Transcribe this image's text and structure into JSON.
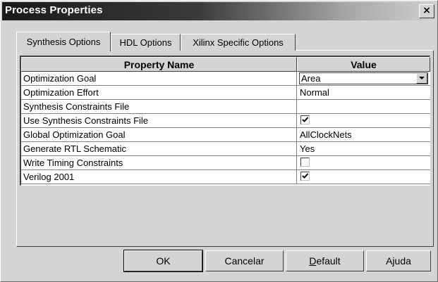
{
  "window": {
    "title": "Process Properties",
    "close_label": "×"
  },
  "tabs": [
    {
      "label": "Synthesis Options",
      "active": true
    },
    {
      "label": "HDL Options",
      "active": false
    },
    {
      "label": "Xilinx Specific Options",
      "active": false
    }
  ],
  "table": {
    "headers": {
      "name": "Property Name",
      "value": "Value"
    },
    "rows": [
      {
        "name": "Optimization Goal",
        "value": "Area",
        "kind": "dropdown"
      },
      {
        "name": "Optimization Effort",
        "value": "Normal",
        "kind": "text"
      },
      {
        "name": "Synthesis Constraints File",
        "value": "",
        "kind": "text"
      },
      {
        "name": "Use Synthesis Constraints File",
        "value": "checked",
        "kind": "checkbox"
      },
      {
        "name": "Global Optimization Goal",
        "value": "AllClockNets",
        "kind": "text"
      },
      {
        "name": "Generate RTL Schematic",
        "value": "Yes",
        "kind": "text"
      },
      {
        "name": "Write Timing Constraints",
        "value": "unchecked",
        "kind": "checkbox"
      },
      {
        "name": "Verilog 2001",
        "value": "checked",
        "kind": "checkbox"
      }
    ]
  },
  "buttons": {
    "ok": "OK",
    "cancel": "Cancelar",
    "default_first": "D",
    "default_rest": "efault",
    "help": "Ajuda"
  },
  "icons": {
    "close": "close-icon",
    "dropdown": "chevron-down-icon",
    "check": "check-icon"
  },
  "colors": {
    "titlebar_start": "#1a1a1a",
    "titlebar_end": "#cfcfcf",
    "face": "#d4d4d4"
  }
}
